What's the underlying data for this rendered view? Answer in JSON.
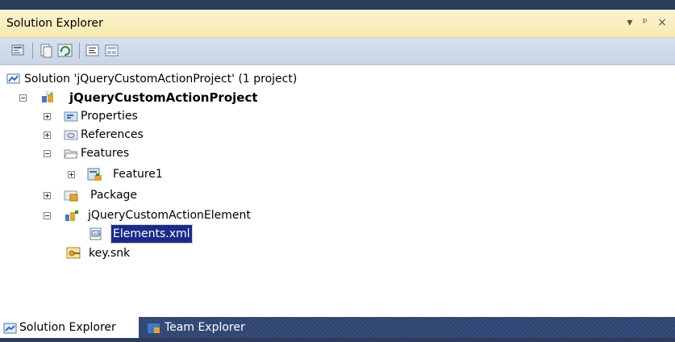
{
  "panel": {
    "title": "Solution Explorer",
    "actions": "▾ ⊥ ×"
  },
  "toolbar": {
    "buttons": [
      "properties-icon",
      "show-all-files-icon",
      "refresh-icon",
      "view-code-icon",
      "view-designer-icon"
    ]
  },
  "tree": {
    "solution": "Solution 'jQueryCustomActionProject' (1 project)",
    "project": "jQueryCustomActionProject",
    "properties": "Properties",
    "references": "References",
    "features": "Features",
    "feature1": "Feature1",
    "package": "Package",
    "element": "jQueryCustomActionElement",
    "elements_xml": "Elements.xml",
    "key": "key.snk"
  },
  "tabs": {
    "solution_explorer": "Solution Explorer",
    "team_explorer": "Team Explorer"
  }
}
